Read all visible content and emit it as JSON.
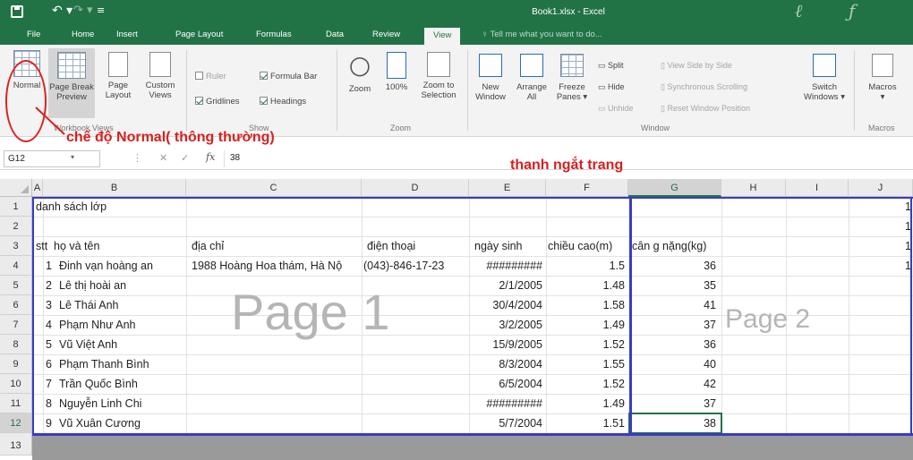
{
  "title_bar": {
    "title": "Book1.xlsx - Excel"
  },
  "tabs": [
    "File",
    "Home",
    "Insert",
    "Page Layout",
    "Formulas",
    "Data",
    "Review",
    "View"
  ],
  "active_tab": "View",
  "tell_me": "Tell me what you want to do...",
  "ribbon": {
    "workbook_views": {
      "label": "Workbook Views",
      "normal": "Normal",
      "page_break_preview_1": "Page Break",
      "page_break_preview_2": "Preview",
      "page_layout_1": "Page",
      "page_layout_2": "Layout",
      "custom_views_1": "Custom",
      "custom_views_2": "Views"
    },
    "show": {
      "label": "Show",
      "ruler": "Ruler",
      "gridlines": "Gridlines",
      "formula_bar": "Formula Bar",
      "headings": "Headings"
    },
    "zoom": {
      "label": "Zoom",
      "zoom": "Zoom",
      "zoom100": "100%",
      "zoom_sel_1": "Zoom to",
      "zoom_sel_2": "Selection"
    },
    "window": {
      "label": "Window",
      "new_window_1": "New",
      "new_window_2": "Window",
      "arrange_1": "Arrange",
      "arrange_2": "All",
      "freeze_1": "Freeze",
      "freeze_2": "Panes",
      "split": "Split",
      "hide": "Hide",
      "unhide": "Unhide",
      "side_by_side": "View Side by Side",
      "sync_scroll": "Synchronous Scrolling",
      "reset_pos": "Reset Window Position",
      "switch_1": "Switch",
      "switch_2": "Windows"
    },
    "macros": {
      "label": "Macros",
      "macros": "Macros"
    }
  },
  "annotations": {
    "normal_mode": "chế độ Normal( thông thường)",
    "page_break": "thanh ngắt trang"
  },
  "formula_bar": {
    "name_box": "G12",
    "fx": "fx",
    "value": "38"
  },
  "columns": [
    "A",
    "B",
    "C",
    "D",
    "E",
    "F",
    "G",
    "H",
    "I",
    "J"
  ],
  "rows": [
    "1",
    "2",
    "3",
    "4",
    "5",
    "6",
    "7",
    "8",
    "9",
    "10",
    "11",
    "12",
    "13"
  ],
  "sheet": {
    "title_cell": "danh sách lớp",
    "headers": {
      "a": "stt",
      "b": "họ và tên",
      "c": "địa chỉ",
      "d": "điện thoại",
      "e": "ngày sinh",
      "f": "chiều cao(m)",
      "g": "cân g nặng(kg)"
    },
    "j_values": [
      "1",
      "1",
      "1",
      "1"
    ],
    "data": [
      {
        "a": "1",
        "b": "Đinh vạn hoàng an",
        "c": "1988 Hoàng Hoa thám, Hà Nộ",
        "d": "(043)-846-17-23",
        "e": "#########",
        "f": "1.5",
        "g": "36"
      },
      {
        "a": "2",
        "b": "Lê thị hoài an",
        "c": "",
        "d": "",
        "e": "2/1/2005",
        "f": "1.48",
        "g": "35"
      },
      {
        "a": "3",
        "b": "Lê Thái Anh",
        "c": "",
        "d": "",
        "e": "30/4/2004",
        "f": "1.58",
        "g": "41"
      },
      {
        "a": "4",
        "b": "Phạm Như Anh",
        "c": "",
        "d": "",
        "e": "3/2/2005",
        "f": "1.49",
        "g": "37"
      },
      {
        "a": "5",
        "b": "Vũ Việt Anh",
        "c": "",
        "d": "",
        "e": "15/9/2005",
        "f": "1.52",
        "g": "36"
      },
      {
        "a": "6",
        "b": "Phạm Thanh Bình",
        "c": "",
        "d": "",
        "e": "8/3/2004",
        "f": "1.55",
        "g": "40"
      },
      {
        "a": "7",
        "b": "Trần Quốc Bình",
        "c": "",
        "d": "",
        "e": "6/5/2004",
        "f": "1.52",
        "g": "42"
      },
      {
        "a": "8",
        "b": "Nguyễn Linh Chi",
        "c": "",
        "d": "",
        "e": "#########",
        "f": "1.49",
        "g": "37"
      },
      {
        "a": "9",
        "b": "Vũ Xuân Cương",
        "c": "",
        "d": "",
        "e": "5/7/2004",
        "f": "1.51",
        "g": "38"
      }
    ],
    "page1_label": "Page 1",
    "page2_label": "Page 2"
  },
  "colors": {
    "accent": "#217346",
    "annotation": "#d62020",
    "page_break": "#3a3ac6"
  }
}
